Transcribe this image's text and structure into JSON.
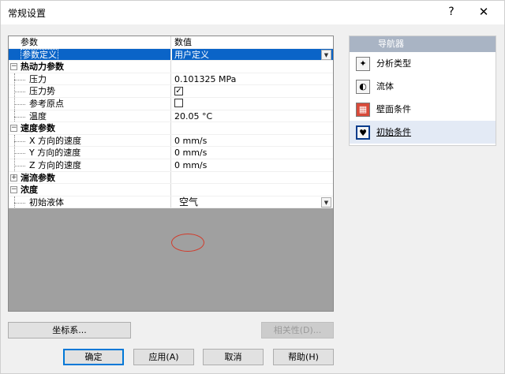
{
  "window": {
    "title": "常规设置",
    "help_glyph": "?",
    "close_glyph": "✕"
  },
  "grid": {
    "header": {
      "param": "参数",
      "value": "数值"
    },
    "rows": [
      {
        "label": "参数定义",
        "value": "用户定义"
      },
      {
        "label": "热动力参数",
        "value": ""
      },
      {
        "label": "压力",
        "value": "0.101325 MPa"
      },
      {
        "label": "压力势",
        "value": ""
      },
      {
        "label": "参考原点",
        "value": ""
      },
      {
        "label": "温度",
        "value": "20.05 °C"
      },
      {
        "label": "速度参数",
        "value": ""
      },
      {
        "label": "X 方向的速度",
        "value": "0 mm/s"
      },
      {
        "label": "Y 方向的速度",
        "value": "0 mm/s"
      },
      {
        "label": "Z 方向的速度",
        "value": "0 mm/s"
      },
      {
        "label": "湍流参数",
        "value": ""
      },
      {
        "label": "浓度",
        "value": ""
      },
      {
        "label": "初始液体",
        "value": "空气"
      }
    ]
  },
  "navigator": {
    "title": "导航器",
    "items": [
      {
        "label": "分析类型"
      },
      {
        "label": "流体"
      },
      {
        "label": "壁面条件"
      },
      {
        "label": "初始条件"
      }
    ]
  },
  "buttons": {
    "coord": "坐标系...",
    "dependency": "相关性(D)...",
    "ok": "确定",
    "apply": "应用(A)",
    "cancel": "取消",
    "help": "帮助(H)"
  }
}
